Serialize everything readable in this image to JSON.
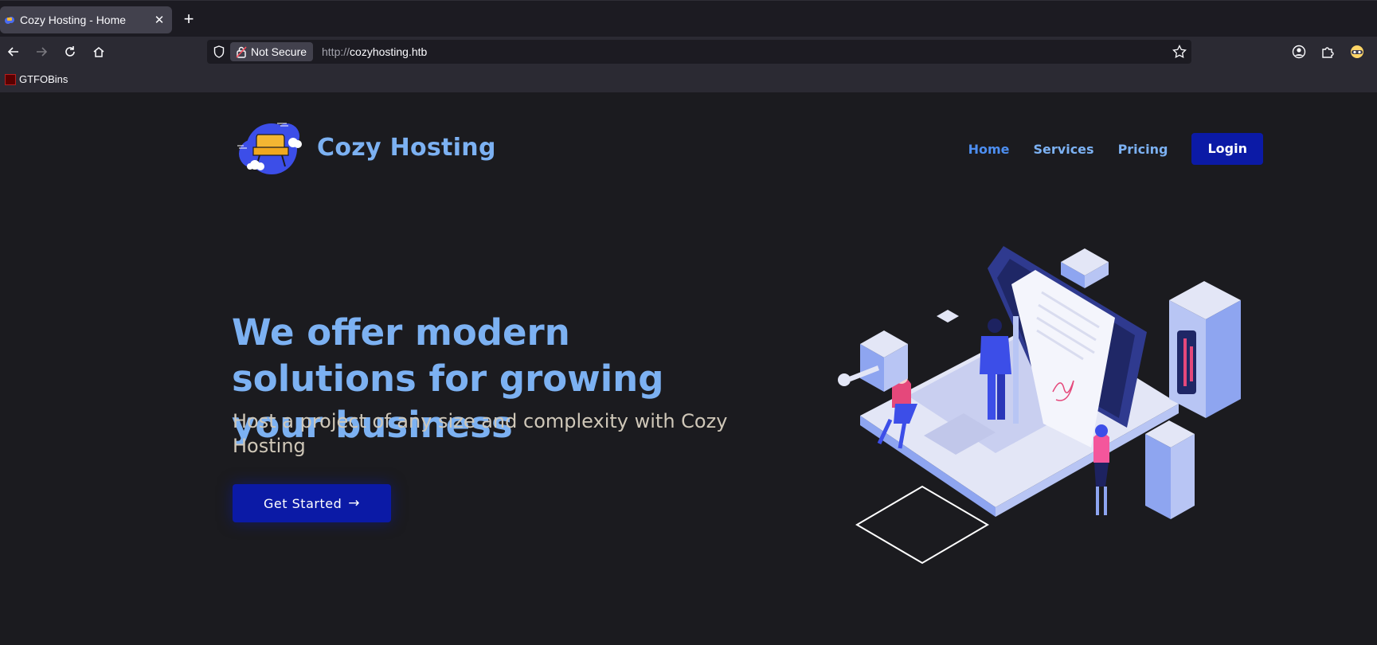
{
  "browser": {
    "tab": {
      "title": "Cozy Hosting - Home",
      "close": "✕"
    },
    "new_tab": "+",
    "url": {
      "security": "Not Secure",
      "scheme": "http://",
      "host": "cozyhosting.htb"
    },
    "bookmarks": [
      {
        "label": "GTFOBins"
      }
    ]
  },
  "site": {
    "brand": "Cozy Hosting",
    "nav": [
      {
        "label": "Home",
        "active": true
      },
      {
        "label": "Services"
      },
      {
        "label": "Pricing"
      }
    ],
    "login": "Login",
    "hero": {
      "title": "We offer modern solutions for growing your business",
      "subtitle": "Host a project of any size and complexity with Cozy Hosting",
      "cta": "Get Started",
      "cta_arrow": "→"
    }
  },
  "colors": {
    "accent": "#7cb1f2",
    "button": "#0b1aa6",
    "background": "#1b1b1f"
  }
}
